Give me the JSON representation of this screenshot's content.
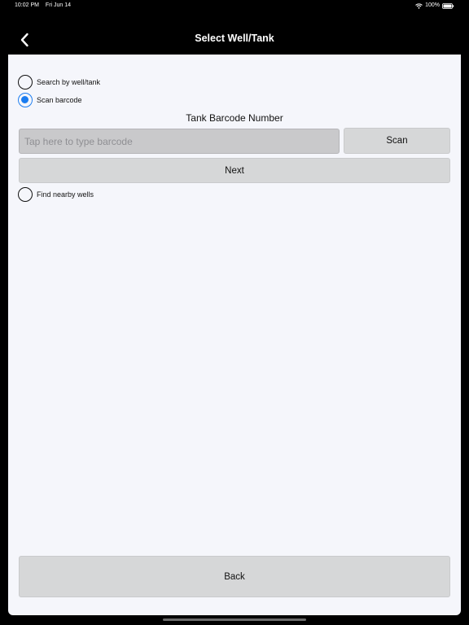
{
  "status_bar": {
    "time": "10:02 PM",
    "date": "Fri Jun 14",
    "battery": "100%",
    "icons": [
      "wifi-icon",
      "battery-icon"
    ]
  },
  "nav": {
    "title": "Select Well/Tank",
    "back_icon": "chevron-left-icon"
  },
  "search_options": [
    {
      "label": "Search by well/tank",
      "checked": false
    },
    {
      "label": "Scan barcode",
      "checked": true
    }
  ],
  "barcode_section": {
    "title": "Tank Barcode Number",
    "input_placeholder": "Tap here to type barcode",
    "input_value": "",
    "scan_label": "Scan",
    "next_label": "Next"
  },
  "nearby_option": {
    "label": "Find nearby wells",
    "checked": false
  },
  "footer": {
    "back_label": "Back"
  },
  "colors": {
    "accent": "#1a7cf0",
    "background": "#000000",
    "card": "#f5f6fb",
    "button": "#d6d7d8"
  }
}
